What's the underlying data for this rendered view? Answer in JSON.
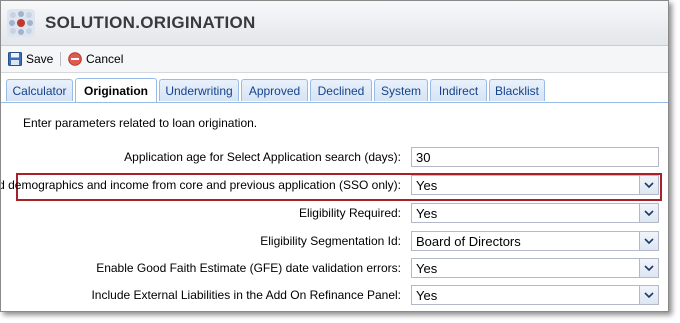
{
  "header": {
    "title": "SOLUTION.ORIGINATION",
    "icon": "app-logo-icon"
  },
  "toolbar": {
    "save_label": "Save",
    "cancel_label": "Cancel",
    "save_icon": "floppy-disk-icon",
    "cancel_icon": "cancel-circle-icon"
  },
  "tabs": [
    {
      "label": "Calculator",
      "active": false
    },
    {
      "label": "Origination",
      "active": true
    },
    {
      "label": "Underwriting",
      "active": false
    },
    {
      "label": "Approved",
      "active": false
    },
    {
      "label": "Declined",
      "active": false
    },
    {
      "label": "System",
      "active": false
    },
    {
      "label": "Indirect",
      "active": false
    },
    {
      "label": "Blacklist",
      "active": false
    }
  ],
  "panel": {
    "intro": "Enter parameters related to loan origination.",
    "rows": [
      {
        "label": "Application age for Select Application search (days):",
        "value": "30",
        "type": "text"
      },
      {
        "label": "Load demographics and income from core and previous application (SSO only):",
        "value": "Yes",
        "type": "select",
        "highlighted": true
      },
      {
        "label": "Eligibility Required:",
        "value": "Yes",
        "type": "select"
      },
      {
        "label": "Eligibility Segmentation Id:",
        "value": "Board of Directors",
        "type": "select"
      },
      {
        "label": "Enable Good Faith Estimate (GFE) date validation errors:",
        "value": "Yes",
        "type": "select"
      },
      {
        "label": "Include External Liabilities in the Add On Refinance Panel:",
        "value": "Yes",
        "type": "select"
      }
    ]
  },
  "colors": {
    "highlight_border": "#a8202a",
    "tab_text": "#15428b",
    "tab_border": "#99bbe8"
  }
}
